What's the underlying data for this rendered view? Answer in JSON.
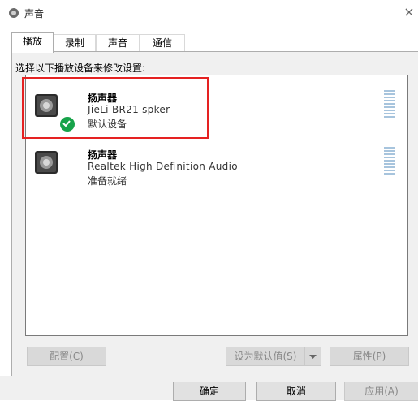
{
  "window": {
    "title": "声音",
    "close_glyph": "×"
  },
  "tabs": [
    {
      "label": "播放",
      "active": true
    },
    {
      "label": "录制",
      "active": false
    },
    {
      "label": "声音",
      "active": false
    },
    {
      "label": "通信",
      "active": false
    }
  ],
  "instruction": "选择以下播放设备来修改设置:",
  "devices": [
    {
      "name": "扬声器",
      "model": "JieLi-BR21 spker",
      "status": "默认设备",
      "is_default": true,
      "icon": "speaker-icon"
    },
    {
      "name": "扬声器",
      "model": "Realtek High Definition Audio",
      "status": "准备就绪",
      "is_default": false,
      "icon": "speaker-icon"
    }
  ],
  "buttons": {
    "configure": "配置(C)",
    "set_default": "设为默认值(S)",
    "properties": "属性(P)",
    "ok": "确定",
    "cancel": "取消",
    "apply": "应用(A)"
  },
  "colors": {
    "highlight_box": "#e52222",
    "default_badge": "#17a34a"
  }
}
